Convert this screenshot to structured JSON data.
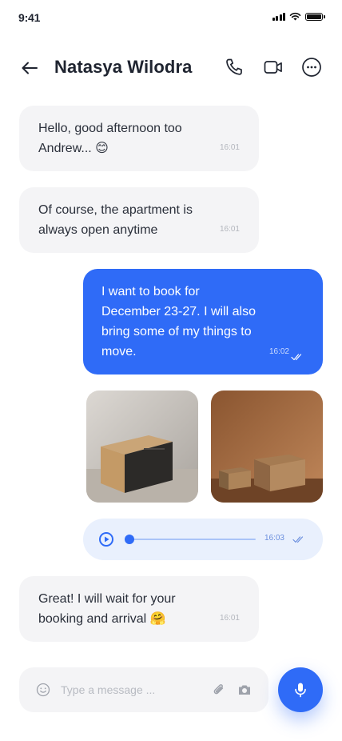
{
  "status_bar": {
    "time": "9:41"
  },
  "header": {
    "contact_name": "Natasya Wilodra"
  },
  "messages": [
    {
      "text": "Hello, good afternoon too Andrew... 😊",
      "time": "16:01"
    },
    {
      "text": "Of course, the apartment is always open anytime",
      "time": "16:01"
    },
    {
      "text": "I want to book for December 23-27. I will also bring some of my things to move.",
      "time": "16:02"
    },
    {
      "text": "Great! I will wait for your booking and arrival 🤗",
      "time": "16:01"
    }
  ],
  "voice_note": {
    "time": "16:03",
    "progress": 0.0
  },
  "composer": {
    "placeholder": "Type a message ..."
  },
  "colors": {
    "accent": "#2f6bf7",
    "incoming_bubble": "#f4f4f6",
    "voice_bubble": "#e9f0fd"
  }
}
